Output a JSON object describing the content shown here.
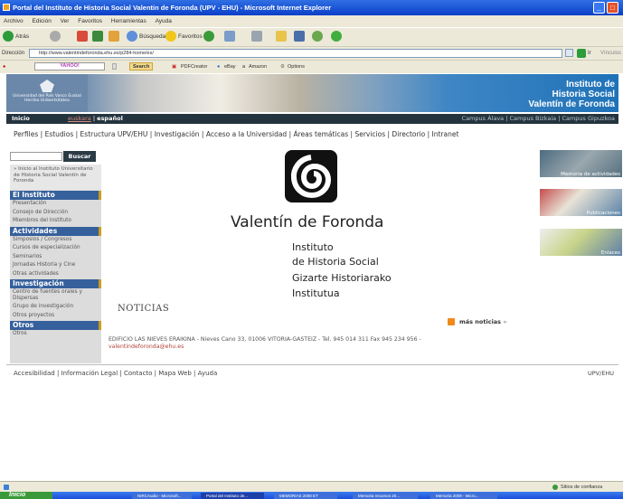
{
  "window": {
    "title": "Portal del Instituto de Historia Social Valentin de Foronda (UPV - EHU) - Microsoft Internet Explorer",
    "menu": [
      "Archivo",
      "Edición",
      "Ver",
      "Favoritos",
      "Herramientas",
      "Ayuda"
    ],
    "toolbar": {
      "back": "Atrás",
      "search": "Búsqueda",
      "favorites": "Favoritos"
    },
    "address_label": "Dirección",
    "address_value": "http://www.valentindeforonda.ehu.es/p284-home/es/",
    "go_label": "Ir",
    "links_label": "Vínculos",
    "yahoo": {
      "brand": "YAHOO!",
      "search_label": "Search",
      "pdf": "PDFCreator",
      "ebay": "eBay",
      "amazon": "Amazon",
      "options": "Options"
    }
  },
  "banner": {
    "title_lines": [
      "Instituto de",
      "Historia Social",
      "Valentín de Foronda"
    ],
    "uni_label": "Universidad del País Vasco  Euskal Herriko Unibertsitatea"
  },
  "navbar": {
    "home": "Inicio",
    "lang_euskara": "euskara",
    "lang_sep": "|",
    "lang_espanol": "español",
    "campuses": "Campus Álava | Campus Bizkaia | Campus Gipuzkoa"
  },
  "topmenu": "Perfiles | Estudios | Estructura UPV/EHU | Investigación | Acceso a la Universidad | Áreas temáticas | Servicios | Directorio | Intranet",
  "search": {
    "button": "Buscar"
  },
  "sidebar": {
    "intro": "» Inicio al Instituto Universitario de Historia Social Valentín de Foronda",
    "sections": [
      {
        "title": "El Instituto",
        "items": [
          "Presentación",
          "Consejo de Dirección",
          "Miembros del Instituto"
        ]
      },
      {
        "title": "Actividades",
        "items": [
          "Simposios / Congresos",
          "Cursos de especialización",
          "Seminarios",
          "Jornadas Historia y Cine",
          "Otras actividades"
        ]
      },
      {
        "title": "Investigación",
        "items": [
          "Centro de fuentes orales y Dispersas",
          "Grupo de investigación",
          "Otros proyectos"
        ]
      },
      {
        "title": "Otros",
        "items": [
          "Otros"
        ]
      }
    ]
  },
  "content": {
    "name": "Valentín de Foronda",
    "subtitle_lines": [
      "Instituto",
      "de Historia Social",
      "Gizarte Historiarako",
      "Institutua"
    ],
    "news_heading": "NOTICIAS",
    "more_news": "más noticias",
    "address": "EDIFICIO LAS NIEVES ERAIKINA - Nieves Cano 33, 01006 VITORIA-GASTEIZ - Tel. 945 014 311  Fax 945 234 956 -",
    "email": "valentindeforonda@ehu.es"
  },
  "thumbs": [
    "Memoria de actividades",
    "Publicaciones",
    "Enlaces"
  ],
  "footer": {
    "links": "Accesibilidad | Información Legal | Contacto | Mapa Web | Ayuda",
    "right": "UPV/EHU"
  },
  "statusbar": {
    "zone": "Sitios de confianza"
  },
  "taskbar": {
    "start": "Inicio",
    "tasks": [
      "NIRCAudio - Microsoft...",
      "Portal del Instituto de...",
      "MEMORIAS 2008 ET",
      "Memoria recursos 20...",
      "Memoria 2009 - Micro..."
    ]
  }
}
